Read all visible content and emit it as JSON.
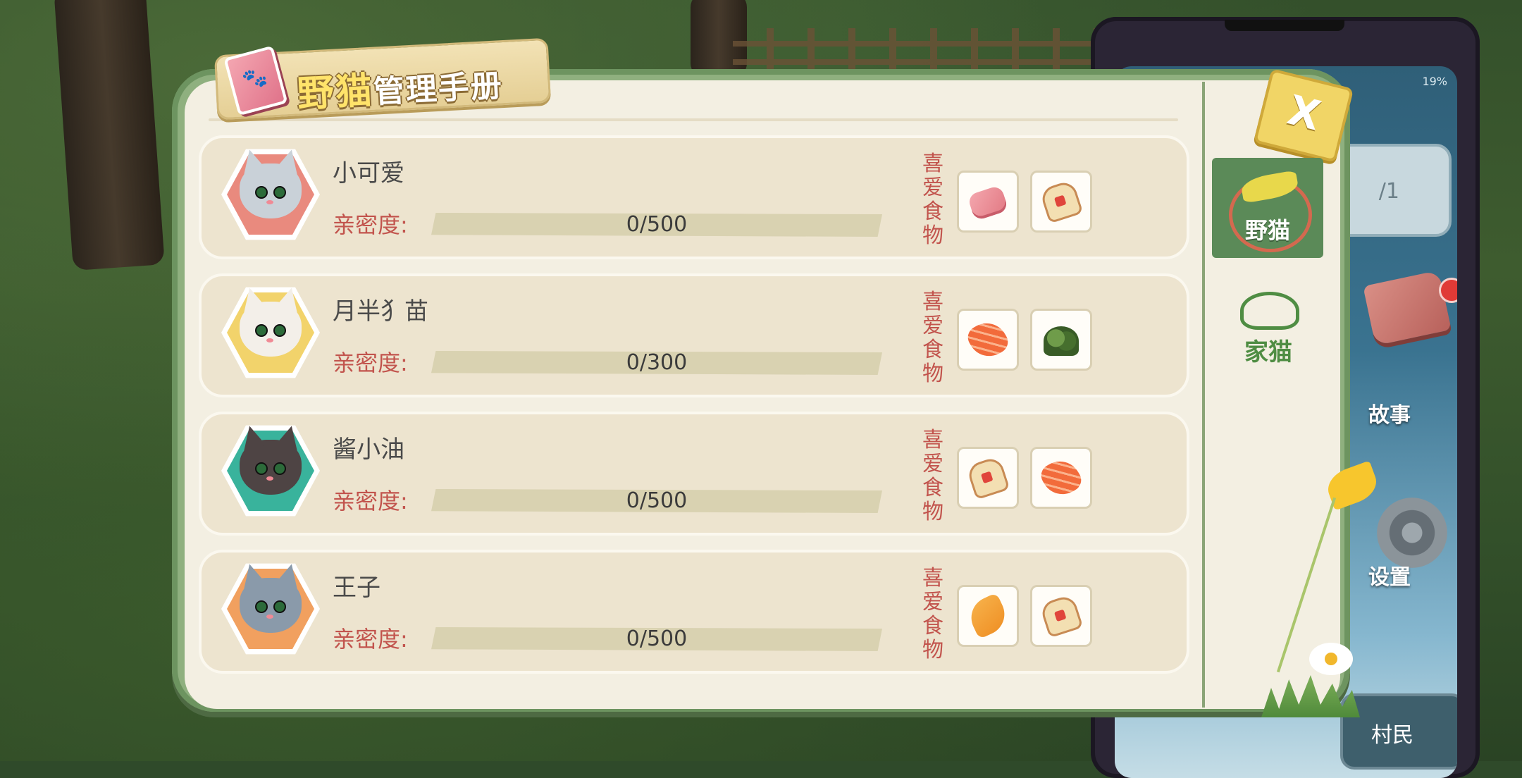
{
  "title": {
    "accent": "野猫",
    "rest": "管理手册"
  },
  "close_label": "X",
  "tabs": {
    "wild": "野猫",
    "home": "家猫"
  },
  "affinity_label": "亲密度:",
  "favorite_label": "喜爱食物",
  "cats": [
    {
      "name": "小可爱",
      "affinity": "0/500",
      "affinity_fraction": 0,
      "avatar_bg": "#e98a7e",
      "fur": "#c9d1d8",
      "foods": [
        "ham-icon",
        "rice-ball-icon"
      ]
    },
    {
      "name": "月半犭苗",
      "affinity": "0/300",
      "affinity_fraction": 0,
      "avatar_bg": "#f2d36b",
      "fur": "#f3efe9",
      "foods": [
        "salmon-icon",
        "seaweed-icon"
      ]
    },
    {
      "name": "酱小油",
      "affinity": "0/500",
      "affinity_fraction": 0,
      "avatar_bg": "#39b39c",
      "fur": "#4e4444",
      "foods": [
        "rice-ball-icon",
        "salmon-icon"
      ]
    },
    {
      "name": "王子",
      "affinity": "0/500",
      "affinity_fraction": 0,
      "avatar_bg": "#f1a05f",
      "fur": "#8a9aaa",
      "foods": [
        "mango-icon",
        "rice-ball-icon"
      ]
    }
  ],
  "phone": {
    "battery": "19%",
    "card_text": "/1",
    "story_label": "故事",
    "settings_label": "设置",
    "villager_label": "村民"
  }
}
